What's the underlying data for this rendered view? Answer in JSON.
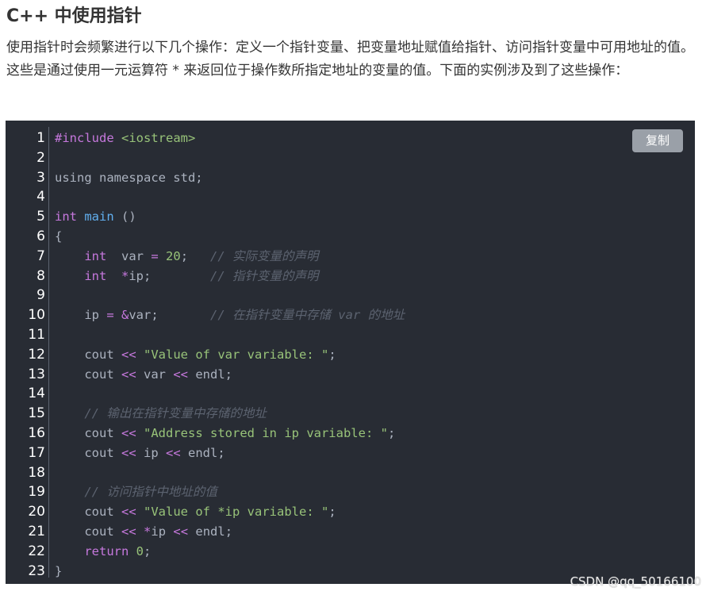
{
  "title": "C++ 中使用指针",
  "paragraph": "使用指针时会频繁进行以下几个操作：定义一个指针变量、把变量地址赋值给指针、访问指针变量中可用地址的值。这些是通过使用一元运算符 * 来返回位于操作数所指定地址的变量的值。下面的实例涉及到了这些操作：",
  "copy_label": "复制",
  "watermark": "CSDN @qq_50166100",
  "line_numbers": [
    "1",
    "2",
    "3",
    "4",
    "5",
    "6",
    "7",
    "8",
    "9",
    "10",
    "11",
    "12",
    "13",
    "14",
    "15",
    "16",
    "17",
    "18",
    "19",
    "20",
    "21",
    "22",
    "23"
  ],
  "code": {
    "l1_pp": "#include",
    "l1_hdr": "<iostream>",
    "l3": "using namespace std;",
    "l5_ty": "int",
    "l5_fn": "main",
    "l5_rest": " ()",
    "l6": "{",
    "l7_ty": "int",
    "l7_a": "  var ",
    "l7_op": "=",
    "l7_num": "20",
    "l7_b": ";   ",
    "l7_cm": "// 实际变量的声明",
    "l8_ty": "int",
    "l8_a": "  ",
    "l8_op": "*",
    "l8_b": "ip;        ",
    "l8_cm": "// 指针变量的声明",
    "l10_a": "ip ",
    "l10_op": "= &",
    "l10_b": "var;       ",
    "l10_cm": "// 在指针变量中存储 var 的地址",
    "l12_a": "cout ",
    "l12_op": "<<",
    "l12_str": "\"Value of var variable: \"",
    "l12_b": ";",
    "l13_a": "cout ",
    "l13_op1": "<<",
    "l13_b": " var ",
    "l13_op2": "<<",
    "l13_c": " endl;",
    "l15_cm": "// 输出在指针变量中存储的地址",
    "l16_a": "cout ",
    "l16_op": "<<",
    "l16_str": "\"Address stored in ip variable: \"",
    "l16_b": ";",
    "l17_a": "cout ",
    "l17_op1": "<<",
    "l17_b": " ip ",
    "l17_op2": "<<",
    "l17_c": " endl;",
    "l19_cm": "// 访问指针中地址的值",
    "l20_a": "cout ",
    "l20_op": "<<",
    "l20_str": "\"Value of *ip variable: \"",
    "l20_b": ";",
    "l21_a": "cout ",
    "l21_op1": "<<",
    "l21_op2": "*",
    "l21_b": "ip ",
    "l21_op3": "<<",
    "l21_c": " endl;",
    "l22_kw": "return",
    "l22_num": "0",
    "l22_b": ";",
    "l23": "}"
  }
}
